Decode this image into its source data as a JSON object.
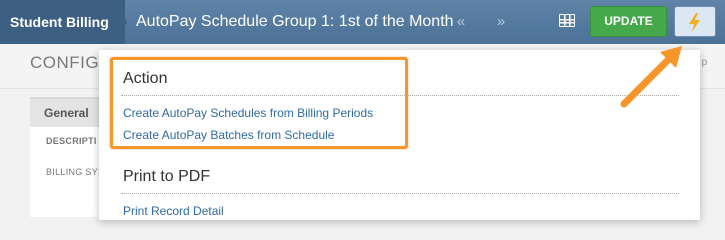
{
  "header": {
    "module": "Student Billing",
    "record_title": "AutoPay Schedule Group 1: 1st of the Month",
    "prev_icon": "«",
    "next_icon": "»",
    "grid_icon": "grid-icon",
    "update_label": "UPDATE",
    "actions_icon": "lightning-bolt-icon"
  },
  "page": {
    "heading": "CONFIGU",
    "right_fragment": "n by p",
    "tab_general": "General",
    "field_description": "DESCRIPTI",
    "field_billing": "BILLING SYS"
  },
  "menu": {
    "action_heading": "Action",
    "action_items": [
      "Create AutoPay Schedules from Billing Periods",
      "Create AutoPay Batches from Schedule"
    ],
    "print_heading": "Print to PDF",
    "print_items": [
      "Print Record Detail"
    ]
  },
  "colors": {
    "topbar": "#5478a0",
    "update": "#45a84a",
    "highlight": "#f5952a",
    "link": "#2f6aa6"
  }
}
